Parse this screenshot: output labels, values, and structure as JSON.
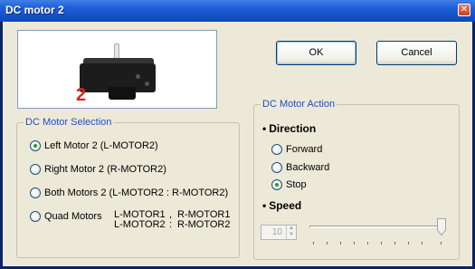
{
  "window": {
    "title": "DC motor 2",
    "close_glyph": "✕"
  },
  "preview": {
    "motor_number": "2"
  },
  "buttons": {
    "ok": "OK",
    "cancel": "Cancel"
  },
  "selection_group": {
    "title": "DC Motor Selection",
    "options": [
      {
        "label": "Left Motor 2 (L-MOTOR2)",
        "checked": true
      },
      {
        "label": "Right Motor 2 (R-MOTOR2)",
        "checked": false
      },
      {
        "label": "Both Motors 2 (L-MOTOR2 : R-MOTOR2)",
        "checked": false
      },
      {
        "label": "Quad Motors",
        "checked": false
      }
    ],
    "quad_left": [
      "L-MOTOR1",
      "L-MOTOR2"
    ],
    "quad_sep": [
      ",",
      ":"
    ],
    "quad_right": [
      "R-MOTOR1",
      "R-MOTOR2"
    ]
  },
  "action_group": {
    "title": "DC Motor Action",
    "direction": {
      "label": "Direction",
      "options": [
        {
          "label": "Forward",
          "checked": false
        },
        {
          "label": "Backward",
          "checked": false
        },
        {
          "label": "Stop",
          "checked": true
        }
      ]
    },
    "speed": {
      "label": "Speed",
      "value": "10",
      "slider_fraction": 1.0,
      "enabled": false
    }
  },
  "colors": {
    "title_bar": "#1452c8",
    "group_title": "#1f4fc2",
    "dialog_bg": "#ece9d8"
  }
}
